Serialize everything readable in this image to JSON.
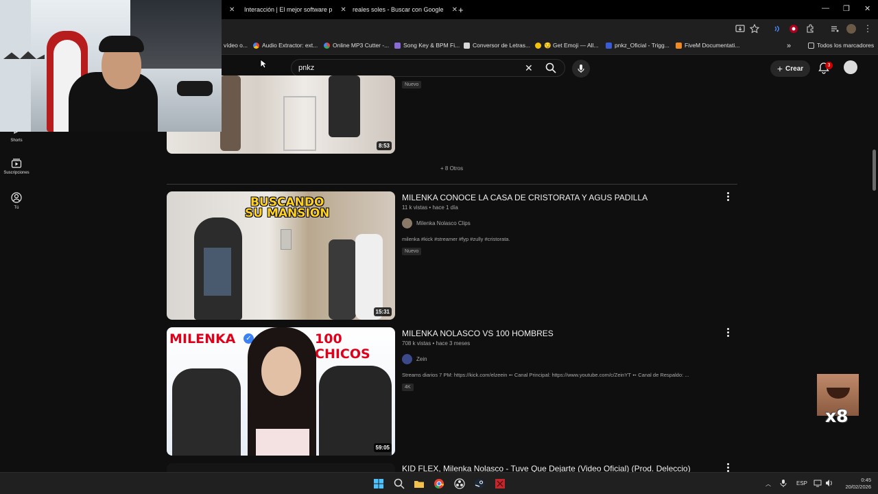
{
  "browser": {
    "tabs": [
      {
        "label": "Interacción | El mejor software p",
        "active": false
      },
      {
        "label": "reales soles - Buscar con Google",
        "active": false
      }
    ],
    "new_tab": "+",
    "window_controls": {
      "minimize": "—",
      "maximize": "❐",
      "close": "✕"
    },
    "bookmarks": [
      {
        "label": "vídeo o..."
      },
      {
        "label": "Audio Extractor: ext..."
      },
      {
        "label": "Online MP3 Cutter -..."
      },
      {
        "label": "Song Key & BPM Fi..."
      },
      {
        "label": "Conversor de Letras..."
      },
      {
        "label": "😏 Get Emoji — All..."
      },
      {
        "label": "pnkz_Oficial - Trigg..."
      },
      {
        "label": "FiveM Documentati..."
      }
    ],
    "bookmarks_more": "»",
    "all_bookmarks": "Todos los marcadores"
  },
  "youtube": {
    "search": {
      "query": "pnkz"
    },
    "create_label": "Crear",
    "notifications_count": "3",
    "sidebar": [
      {
        "label": "Shorts",
        "icon": "shorts-icon"
      },
      {
        "label": "Suscripciones",
        "icon": "subscriptions-icon"
      },
      {
        "label": "Tú",
        "icon": "you-icon"
      }
    ],
    "top_video": {
      "duration": "8:53",
      "tag": "Nuevo"
    },
    "more_link": "+ 8 Otros",
    "videos": [
      {
        "title": "MILENKA CONOCE LA CASA DE CRISTORATA Y AGUS PADILLA",
        "meta": "11 k vistas • hace 1 día",
        "channel": "Milenka Nolasco Clips",
        "description": "milenka #kick #streamer #fyp #zully #cristorata.",
        "tag": "Nuevo",
        "duration": "15:31",
        "thumb_text": [
          "BUSCANDO",
          "SU MANSION"
        ]
      },
      {
        "title": "MILENKA NOLASCO VS 100 HOMBRES",
        "meta": "708 k vistas • hace 3 meses",
        "channel": "Zein",
        "description": "Streams diarios 7 PM: https://kick.com/elzeein ➻ Canal Principal: https://www.youtube.com/c/ZeinYT ➻ Canal de Respaldo: ...",
        "tag": "4K",
        "duration": "59:05",
        "thumb_text": [
          "MILENKA",
          "100 CHICOS"
        ]
      },
      {
        "title": "KID FLEX, Milenka Nolasco - Tuve Que Dejarte (Video Oficial) (Prod. Deleccio)"
      }
    ]
  },
  "overlay": {
    "multiplier": "x8"
  },
  "taskbar": {
    "language": "ESP",
    "time": "0:45",
    "date": "20/02/2026"
  }
}
